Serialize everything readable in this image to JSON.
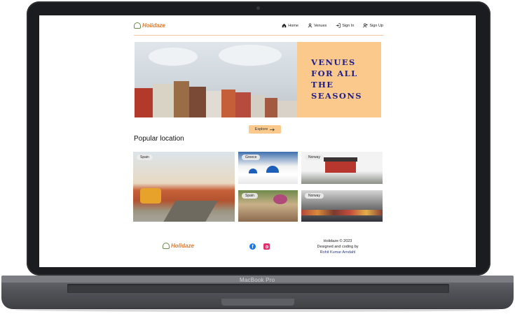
{
  "device": {
    "brand_label": "MacBook Pro"
  },
  "nav": {
    "logo": "Holidaze",
    "items": [
      {
        "label": "Home",
        "icon": "home-icon"
      },
      {
        "label": "Venues",
        "icon": "user-icon"
      },
      {
        "label": "Sign In",
        "icon": "sign-in-icon"
      },
      {
        "label": "Sign Up",
        "icon": "user-plus-icon"
      }
    ]
  },
  "hero": {
    "headline_lines": [
      "VENUES",
      "FOR ALL",
      "THE",
      "SEASONS"
    ],
    "panel_color": "#fbc98b",
    "text_color": "#1e1e8c"
  },
  "explore_button": {
    "label": "Explore",
    "icon": "arrow-right-icon"
  },
  "section": {
    "title": "Popular location"
  },
  "locations": [
    {
      "tag": "Spain"
    },
    {
      "tag": "Greece"
    },
    {
      "tag": "Norway"
    },
    {
      "tag": "Spain"
    },
    {
      "tag": "Norway"
    }
  ],
  "footer": {
    "logo": "Holidaze",
    "copyright": "Holidaze © 2023",
    "designed_by": "Designed and coding by",
    "author": "Rohit Kumar Arndahl"
  },
  "colors": {
    "accent": "#e27b2f",
    "peach": "#fbc98b"
  }
}
